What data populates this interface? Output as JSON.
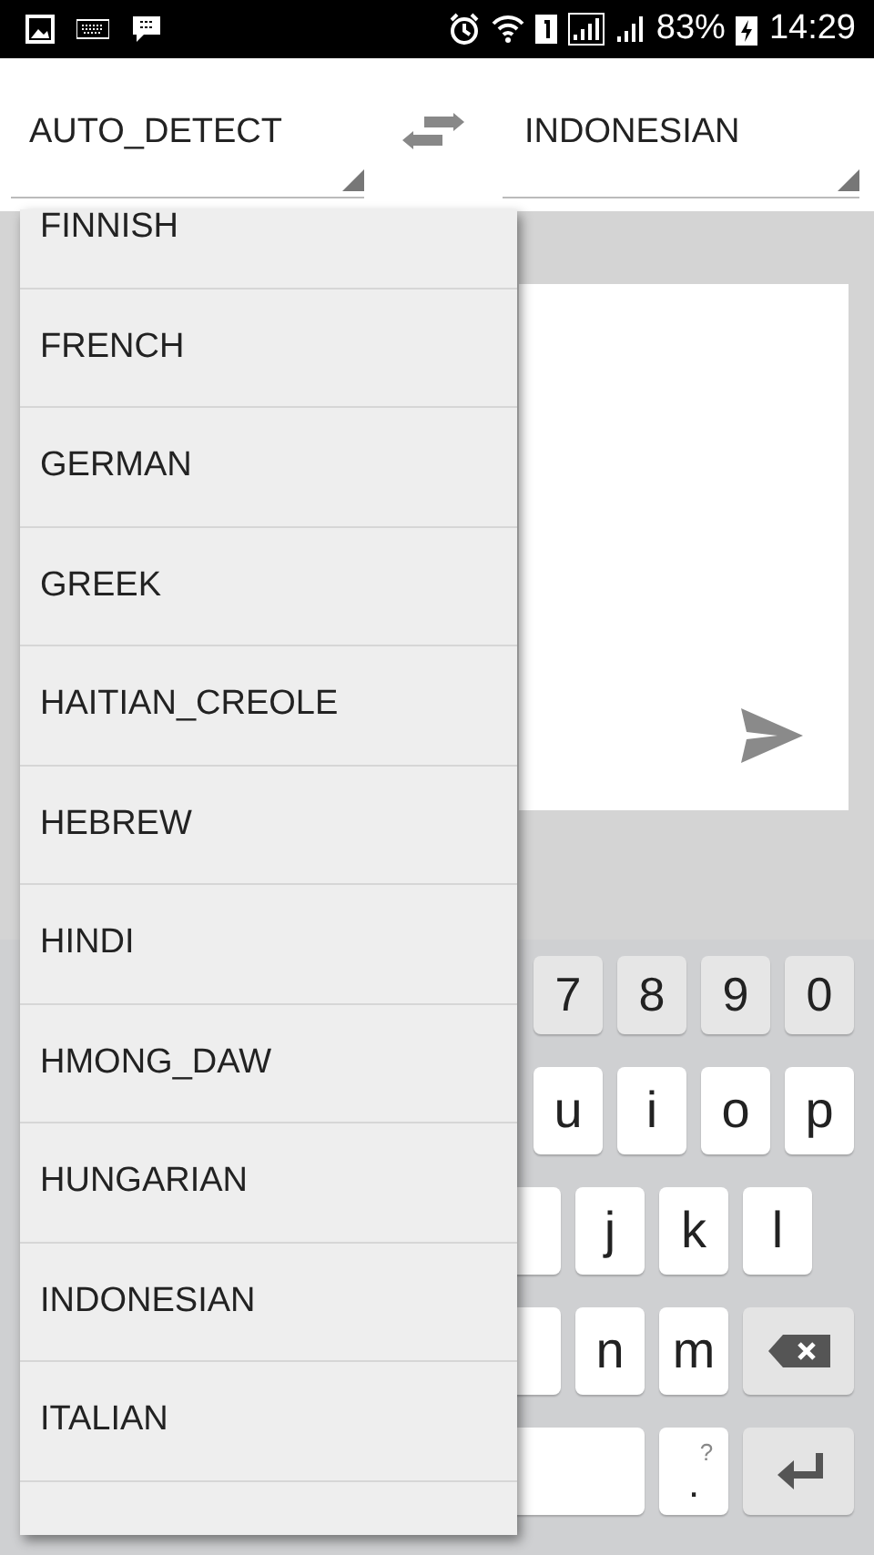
{
  "status_bar": {
    "battery": "83%",
    "time": "14:29"
  },
  "source_language": "AUTO_DETECT",
  "target_language": "INDONESIAN",
  "dropdown": {
    "items": [
      {
        "label": "FINNISH"
      },
      {
        "label": "FRENCH"
      },
      {
        "label": "GERMAN"
      },
      {
        "label": "GREEK"
      },
      {
        "label": "HAITIAN_CREOLE"
      },
      {
        "label": "HEBREW"
      },
      {
        "label": "HINDI"
      },
      {
        "label": "HMONG_DAW"
      },
      {
        "label": "HUNGARIAN"
      },
      {
        "label": "INDONESIAN"
      },
      {
        "label": "ITALIAN"
      }
    ]
  },
  "keyboard": {
    "rows": [
      [
        {
          "kind": "char",
          "label": "7"
        },
        {
          "kind": "char",
          "label": "8"
        },
        {
          "kind": "char",
          "label": "9"
        },
        {
          "kind": "char",
          "label": "0"
        }
      ],
      [
        {
          "kind": "char",
          "label": "u"
        },
        {
          "kind": "char",
          "label": "i"
        },
        {
          "kind": "char",
          "label": "o"
        },
        {
          "kind": "char",
          "label": "p"
        }
      ],
      [
        {
          "kind": "blank"
        },
        {
          "kind": "char",
          "label": "j"
        },
        {
          "kind": "char",
          "label": "k"
        },
        {
          "kind": "char",
          "label": "l"
        }
      ],
      [
        {
          "kind": "blank"
        },
        {
          "kind": "char",
          "label": "n"
        },
        {
          "kind": "char",
          "label": "m"
        },
        {
          "kind": "backspace"
        }
      ],
      [
        {
          "kind": "space"
        },
        {
          "kind": "punct",
          "label": ".",
          "hint": "?"
        },
        {
          "kind": "enter"
        }
      ]
    ]
  }
}
